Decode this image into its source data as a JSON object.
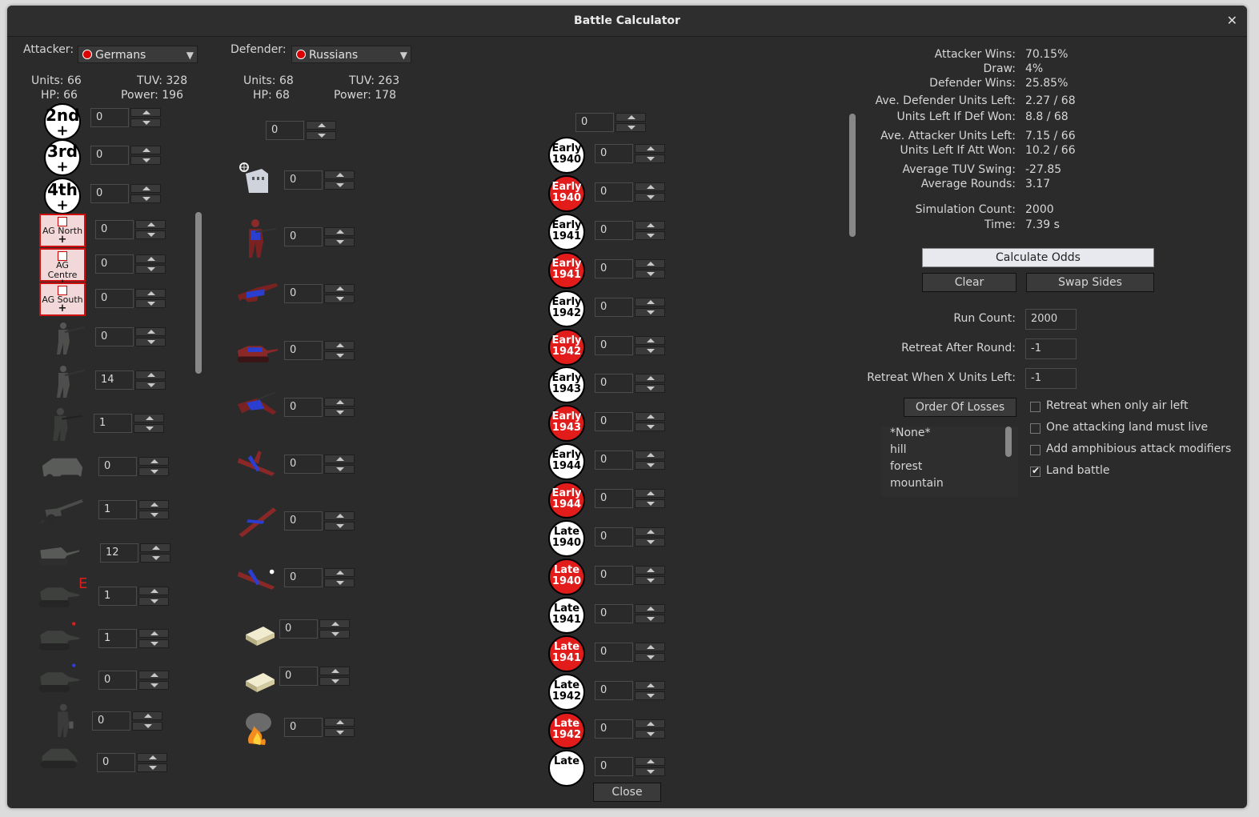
{
  "window": {
    "title": "Battle Calculator",
    "close_label": "Close"
  },
  "attacker": {
    "label": "Attacker:",
    "nation": "Germans",
    "units_label": "Units: 66",
    "hp_label": "HP: 66",
    "tuv_label": "TUV: 328",
    "power_label": "Power: 196",
    "orders": [
      {
        "text": "2nd",
        "value": "0"
      },
      {
        "text": "3rd",
        "value": "0"
      },
      {
        "text": "4th",
        "value": "0"
      }
    ],
    "army_groups": [
      {
        "text": "AG North",
        "value": "0"
      },
      {
        "text": "AG Centre",
        "value": "0"
      },
      {
        "text": "AG South",
        "value": "0"
      }
    ],
    "unit_values": [
      "0",
      "14",
      "1",
      "0",
      "1",
      "12",
      "1",
      "1",
      "0",
      "0",
      "0"
    ],
    "unit_badges": {
      "heavy_tank": "E"
    }
  },
  "defender": {
    "label": "Defender:",
    "nation": "Russians",
    "units_label": "Units: 68",
    "hp_label": "HP: 68",
    "tuv_label": "TUV: 263",
    "power_label": "Power: 178",
    "top_value": "0",
    "unit_values": [
      "0",
      "0",
      "0",
      "0",
      "0",
      "0",
      "0",
      "0",
      "0",
      "0",
      "0"
    ]
  },
  "tech": {
    "top_value": "0",
    "chips": [
      {
        "l1": "Early",
        "l2": "1940",
        "red": false,
        "value": "0"
      },
      {
        "l1": "Early",
        "l2": "1940",
        "red": true,
        "value": "0"
      },
      {
        "l1": "Early",
        "l2": "1941",
        "red": false,
        "value": "0"
      },
      {
        "l1": "Early",
        "l2": "1941",
        "red": true,
        "value": "0"
      },
      {
        "l1": "Early",
        "l2": "1942",
        "red": false,
        "value": "0"
      },
      {
        "l1": "Early",
        "l2": "1942",
        "red": true,
        "value": "0"
      },
      {
        "l1": "Early",
        "l2": "1943",
        "red": false,
        "value": "0"
      },
      {
        "l1": "Early",
        "l2": "1943",
        "red": true,
        "value": "0"
      },
      {
        "l1": "Early",
        "l2": "1944",
        "red": false,
        "value": "0"
      },
      {
        "l1": "Early",
        "l2": "1944",
        "red": true,
        "value": "0"
      },
      {
        "l1": "Late",
        "l2": "1940",
        "red": false,
        "value": "0"
      },
      {
        "l1": "Late",
        "l2": "1940",
        "red": true,
        "value": "0"
      },
      {
        "l1": "Late",
        "l2": "1941",
        "red": false,
        "value": "0"
      },
      {
        "l1": "Late",
        "l2": "1941",
        "red": true,
        "value": "0"
      },
      {
        "l1": "Late",
        "l2": "1942",
        "red": false,
        "value": "0"
      },
      {
        "l1": "Late",
        "l2": "1942",
        "red": true,
        "value": "0"
      },
      {
        "l1": "Late",
        "l2": "",
        "red": false,
        "value": "0"
      }
    ]
  },
  "results": {
    "attacker_wins_label": "Attacker Wins:",
    "attacker_wins": "70.15%",
    "draw_label": "Draw:",
    "draw": "4%",
    "defender_wins_label": "Defender Wins:",
    "defender_wins": "25.85%",
    "ave_def_left_label": "Ave. Defender Units Left:",
    "ave_def_left": "2.27 / 68",
    "def_won_left_label": "Units Left If Def Won:",
    "def_won_left": "8.8 / 68",
    "ave_att_left_label": "Ave. Attacker Units Left:",
    "ave_att_left": "7.15 / 66",
    "att_won_left_label": "Units Left If Att Won:",
    "att_won_left": "10.2 / 66",
    "tuv_swing_label": "Average TUV Swing:",
    "tuv_swing": "-27.85",
    "rounds_label": "Average Rounds:",
    "rounds": "3.17",
    "sim_count_label": "Simulation Count:",
    "sim_count": "2000",
    "time_label": "Time:",
    "time": "7.39 s"
  },
  "actions": {
    "calculate": "Calculate Odds",
    "clear": "Clear",
    "swap": "Swap Sides",
    "order_of_losses": "Order Of Losses"
  },
  "settings": {
    "run_count_label": "Run Count:",
    "run_count": "2000",
    "retreat_round_label": "Retreat After Round:",
    "retreat_round": "-1",
    "retreat_units_label": "Retreat When X Units Left:",
    "retreat_units": "-1"
  },
  "terrain": [
    "*None*",
    "hill",
    "forest",
    "mountain"
  ],
  "options": [
    {
      "label": "Retreat when only air left",
      "checked": false
    },
    {
      "label": "One attacking land must live",
      "checked": false
    },
    {
      "label": "Add amphibious attack modifiers",
      "checked": false
    },
    {
      "label": "Land battle",
      "checked": true
    }
  ],
  "colors": {
    "accent_red": "#e21b1b",
    "panel": "#2b2b2b",
    "text": "#d6d6d6"
  }
}
